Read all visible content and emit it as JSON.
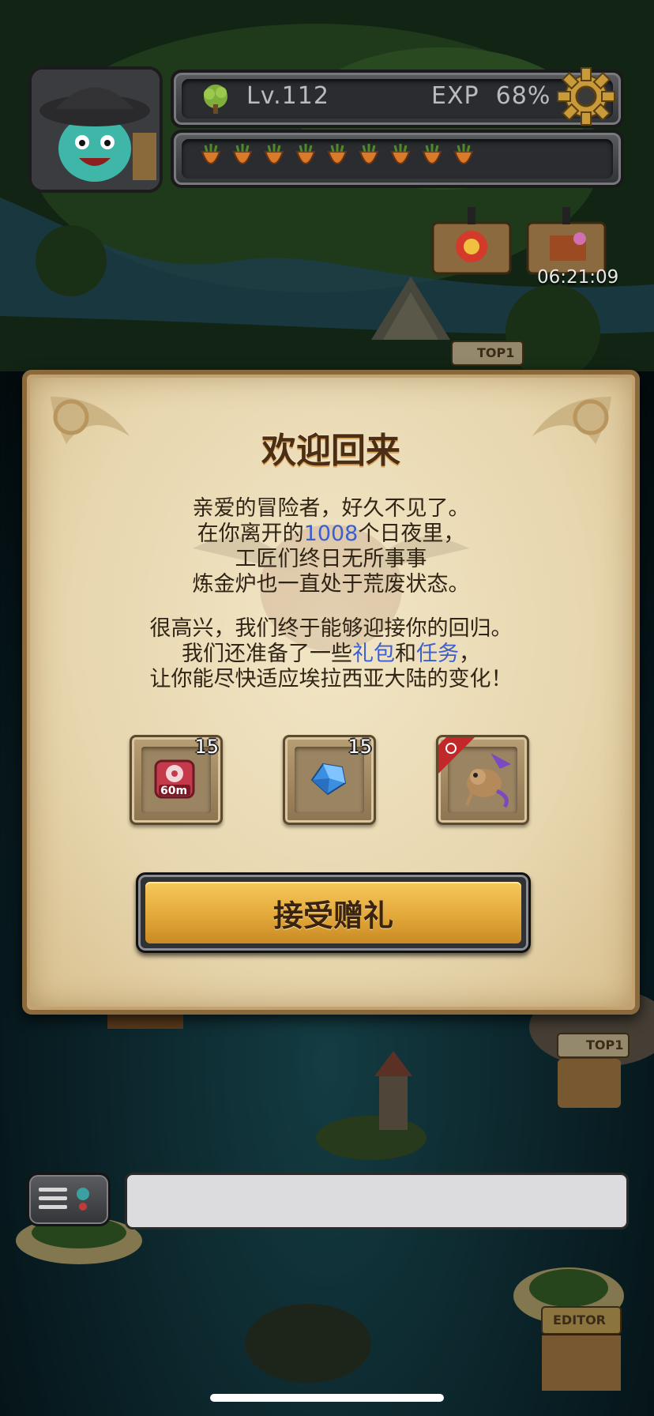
{
  "hud": {
    "level": "Lv.112",
    "exp": "EXP  68%",
    "energy_count": 9,
    "timer": "06:21:09"
  },
  "map_labels": {
    "top1_a": "TOP1",
    "top1_b": "TOP1",
    "editor": "EDITOR"
  },
  "dialog": {
    "title": "欢迎回来",
    "line1": "亲爱的冒险者，好久不见了。",
    "line2_pre": "在你离开的",
    "line2_days": "1008",
    "line2_post": "个日夜里，",
    "line3": "工匠们终日无所事事",
    "line4": "炼金炉也一直处于荒废状态。",
    "line5": "很高兴，我们终于能够迎接你的回归。",
    "line6_pre": "我们还准备了一些",
    "line6_gift": "礼包",
    "line6_and": "和",
    "line6_task": "任务",
    "line6_post": "，",
    "line7": "让你能尽快适应埃拉西亚大陆的变化！",
    "rewards": [
      {
        "icon": "speedup-60m-icon",
        "label": "60m",
        "count": "15"
      },
      {
        "icon": "blue-crystal-icon",
        "count": "15"
      },
      {
        "icon": "dragon-pet-icon",
        "count": ""
      }
    ],
    "accept_label": "接受赠礼"
  },
  "colors": {
    "highlight": "#3c5fcf",
    "button": "#e3a93a",
    "parchment": "#ecdcb6"
  }
}
